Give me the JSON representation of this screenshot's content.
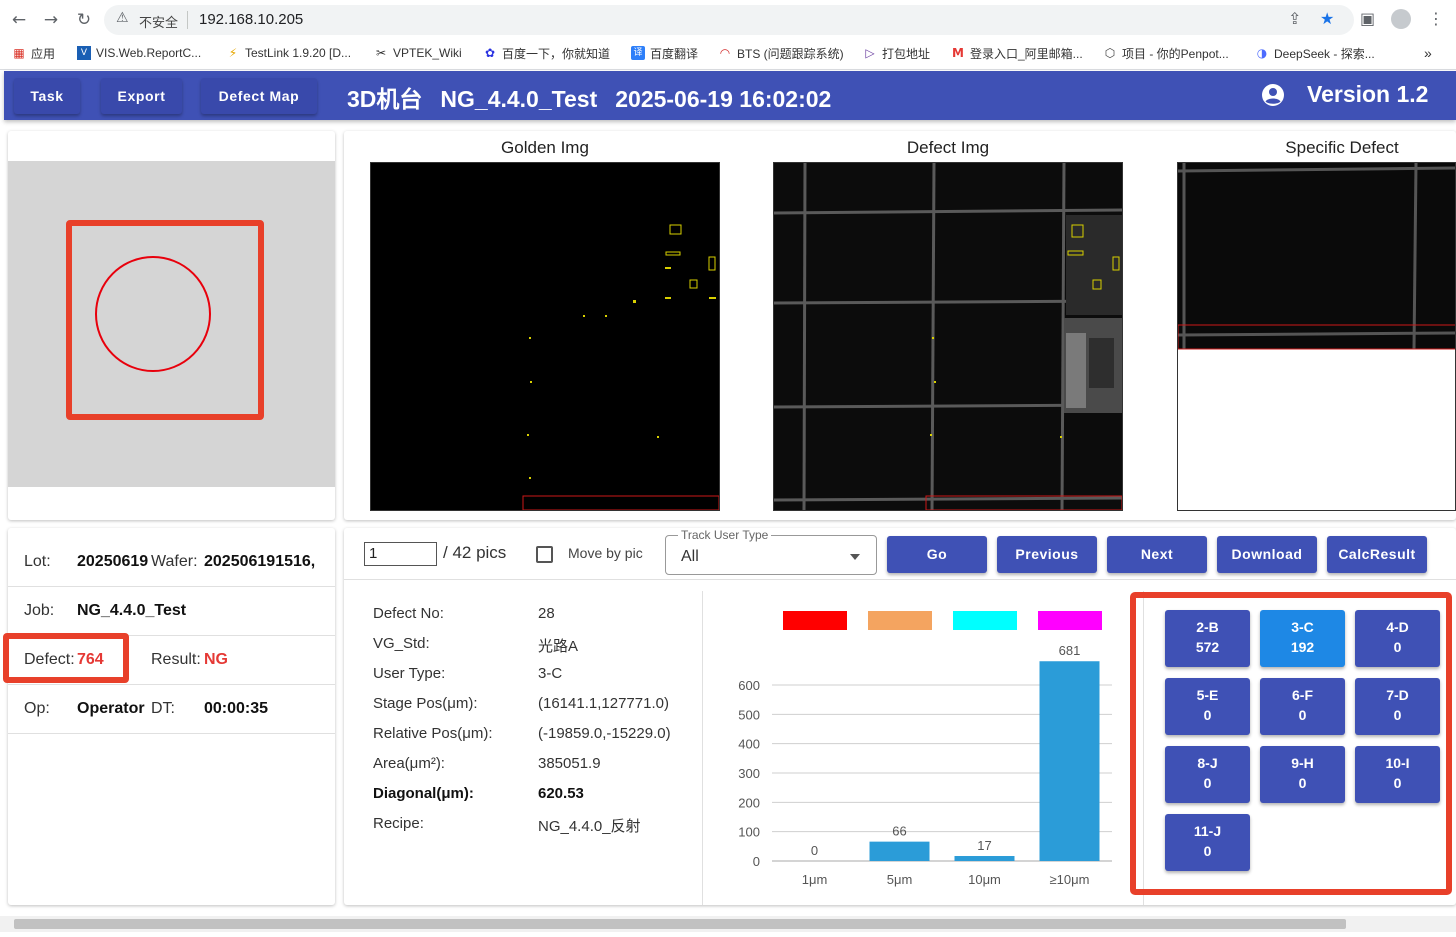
{
  "browser": {
    "insecure_label": "不安全",
    "url": "192.168.10.205",
    "bookmarks": [
      {
        "label": "应用",
        "icon": "apps-grid-icon"
      },
      {
        "label": "VIS.Web.ReportC...",
        "icon": "page-icon"
      },
      {
        "label": "TestLink 1.9.20 [D...",
        "icon": "testlink-icon"
      },
      {
        "label": "VPTEK_Wiki",
        "icon": "wiki-icon"
      },
      {
        "label": "百度一下，你就知道",
        "icon": "baidu-icon"
      },
      {
        "label": "百度翻译",
        "icon": "translate-icon"
      },
      {
        "label": "BTS (问题跟踪系统)",
        "icon": "bts-icon"
      },
      {
        "label": "打包地址",
        "icon": "play-icon"
      },
      {
        "label": "登录入口_阿里邮箱...",
        "icon": "mail-icon"
      },
      {
        "label": "项目 - 你的Penpot...",
        "icon": "cube-icon"
      },
      {
        "label": "DeepSeek - 探索...",
        "icon": "deepseek-icon"
      }
    ]
  },
  "header": {
    "nav": [
      "Task",
      "Export",
      "Defect Map"
    ],
    "machine": "3D机台",
    "recipe": "NG_4.4.0_Test",
    "datetime": "2025-06-19 16:02:02",
    "version": "Version 1.2"
  },
  "images": {
    "golden_title": "Golden Img",
    "defect_title": "Defect Img",
    "specific_title": "Specific Defect"
  },
  "info": {
    "lot_label": "Lot:",
    "lot_value": "20250619",
    "wafer_label": "Wafer:",
    "wafer_value": "202506191516,",
    "job_label": "Job:",
    "job_value": "NG_4.4.0_Test",
    "defect_label": "Defect:",
    "defect_value": "764",
    "result_label": "Result:",
    "result_value": "NG",
    "op_label": "Op:",
    "op_value": "Operator",
    "dt_label": "DT:",
    "dt_value": "00:00:35"
  },
  "controls": {
    "page_value": "1",
    "page_total": "/ 42 pics",
    "move_by_pic": "Move by pic",
    "track_user_type_label": "Track User Type",
    "track_user_type_value": "All",
    "buttons": [
      "Go",
      "Previous",
      "Next",
      "Download",
      "CalcResult"
    ]
  },
  "details": [
    {
      "label": "Defect No:",
      "value": "28",
      "bold": false
    },
    {
      "label": "VG_Std:",
      "value": "光路A",
      "bold": false
    },
    {
      "label": "User Type:",
      "value": "3-C",
      "bold": false
    },
    {
      "label": "Stage Pos(μm):",
      "value": "(16141.1,127771.0)",
      "bold": false
    },
    {
      "label": "Relative Pos(μm):",
      "value": "(-19859.0,-15229.0)",
      "bold": false
    },
    {
      "label": "Area(μm²):",
      "value": "385051.9",
      "bold": false
    },
    {
      "label": "Diagonal(μm):",
      "value": "620.53",
      "bold": true
    },
    {
      "label": "Recipe:",
      "value": "NG_4.4.0_反射",
      "bold": false
    }
  ],
  "chart_data": {
    "type": "bar",
    "categories": [
      "1μm",
      "5μm",
      "10μm",
      "≥10μm"
    ],
    "values": [
      0,
      66,
      17,
      681
    ],
    "ylim": [
      0,
      600
    ],
    "yticks": [
      0,
      100,
      200,
      300,
      400,
      500,
      600
    ],
    "legend_colors": [
      "#ff0000",
      "#f4a460",
      "#00ffff",
      "#ff00ff"
    ],
    "bar_color": "#2b9cd8",
    "grid": true
  },
  "user_types": [
    {
      "name": "2-B",
      "count": "572",
      "active": false
    },
    {
      "name": "3-C",
      "count": "192",
      "active": true
    },
    {
      "name": "4-D",
      "count": "0",
      "active": false
    },
    {
      "name": "5-E",
      "count": "0",
      "active": false
    },
    {
      "name": "6-F",
      "count": "0",
      "active": false
    },
    {
      "name": "7-D",
      "count": "0",
      "active": false
    },
    {
      "name": "8-J",
      "count": "0",
      "active": false
    },
    {
      "name": "9-H",
      "count": "0",
      "active": false
    },
    {
      "name": "10-I",
      "count": "0",
      "active": false
    },
    {
      "name": "11-J",
      "count": "0",
      "active": false
    }
  ],
  "colors": {
    "header": "#3f51b5",
    "highlight": "#e8402a",
    "active_type": "#1e88e5"
  }
}
